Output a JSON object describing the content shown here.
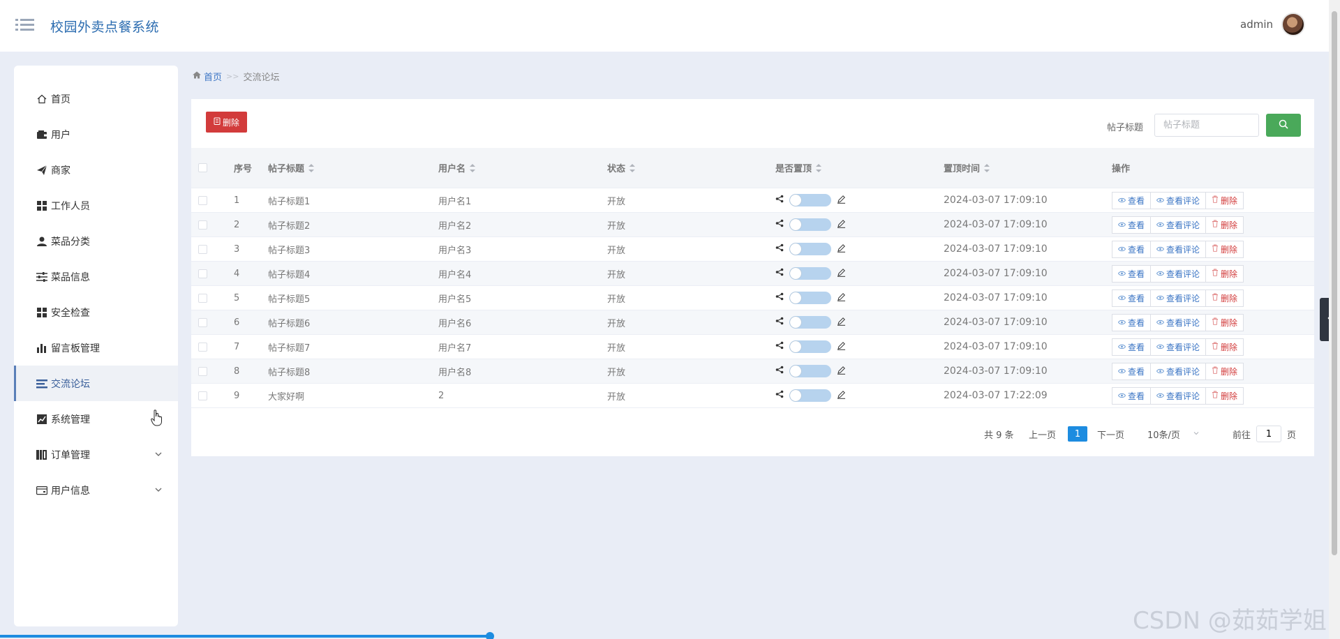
{
  "header": {
    "app_title": "校园外卖点餐系统",
    "username": "admin"
  },
  "sidebar": {
    "items": [
      {
        "label": "首页",
        "icon": "home-icon"
      },
      {
        "label": "用户",
        "icon": "wallet-icon"
      },
      {
        "label": "商家",
        "icon": "paper-plane-icon"
      },
      {
        "label": "工作人员",
        "icon": "grid-icon"
      },
      {
        "label": "菜品分类",
        "icon": "user-icon"
      },
      {
        "label": "菜品信息",
        "icon": "sliders-icon"
      },
      {
        "label": "安全检查",
        "icon": "grid-icon"
      },
      {
        "label": "留言板管理",
        "icon": "bar-chart-icon"
      },
      {
        "label": "交流论坛",
        "icon": "list-icon",
        "active": true
      },
      {
        "label": "系统管理",
        "icon": "line-chart-icon"
      },
      {
        "label": "订单管理",
        "icon": "book-icon",
        "expandable": true
      },
      {
        "label": "用户信息",
        "icon": "card-icon",
        "expandable": true
      }
    ]
  },
  "breadcrumb": {
    "home": "首页",
    "separator": ">>",
    "current": "交流论坛"
  },
  "toolbar": {
    "delete_label": "删除",
    "search_label": "帖子标题",
    "search_placeholder": "帖子标题"
  },
  "table": {
    "headers": [
      "序号",
      "帖子标题",
      "用户名",
      "状态",
      "是否置顶",
      "置顶时间",
      "操作"
    ],
    "rows": [
      {
        "index": "1",
        "title": "帖子标题1",
        "user": "用户名1",
        "status": "开放",
        "time": "2024-03-07 17:09:10"
      },
      {
        "index": "2",
        "title": "帖子标题2",
        "user": "用户名2",
        "status": "开放",
        "time": "2024-03-07 17:09:10"
      },
      {
        "index": "3",
        "title": "帖子标题3",
        "user": "用户名3",
        "status": "开放",
        "time": "2024-03-07 17:09:10"
      },
      {
        "index": "4",
        "title": "帖子标题4",
        "user": "用户名4",
        "status": "开放",
        "time": "2024-03-07 17:09:10"
      },
      {
        "index": "5",
        "title": "帖子标题5",
        "user": "用户名5",
        "status": "开放",
        "time": "2024-03-07 17:09:10"
      },
      {
        "index": "6",
        "title": "帖子标题6",
        "user": "用户名6",
        "status": "开放",
        "time": "2024-03-07 17:09:10"
      },
      {
        "index": "7",
        "title": "帖子标题7",
        "user": "用户名7",
        "status": "开放",
        "time": "2024-03-07 17:09:10"
      },
      {
        "index": "8",
        "title": "帖子标题8",
        "user": "用户名8",
        "status": "开放",
        "time": "2024-03-07 17:09:10"
      },
      {
        "index": "9",
        "title": "大家好啊",
        "user": "2",
        "status": "开放",
        "time": "2024-03-07 17:22:09"
      }
    ],
    "actions": {
      "view": "查看",
      "view_comments": "查看评论",
      "delete": "删除"
    }
  },
  "pagination": {
    "total": "共 9 条",
    "prev": "上一页",
    "current_page": "1",
    "next": "下一页",
    "page_size": "10条/页",
    "goto_label": "前往",
    "goto_value": "1",
    "page_suffix": "页"
  },
  "watermark": "CSDN @茹茹学姐",
  "colors": {
    "accent": "#1d8ce0",
    "danger": "#d23b3b",
    "success": "#4aa95a",
    "link": "#3a74c4"
  }
}
